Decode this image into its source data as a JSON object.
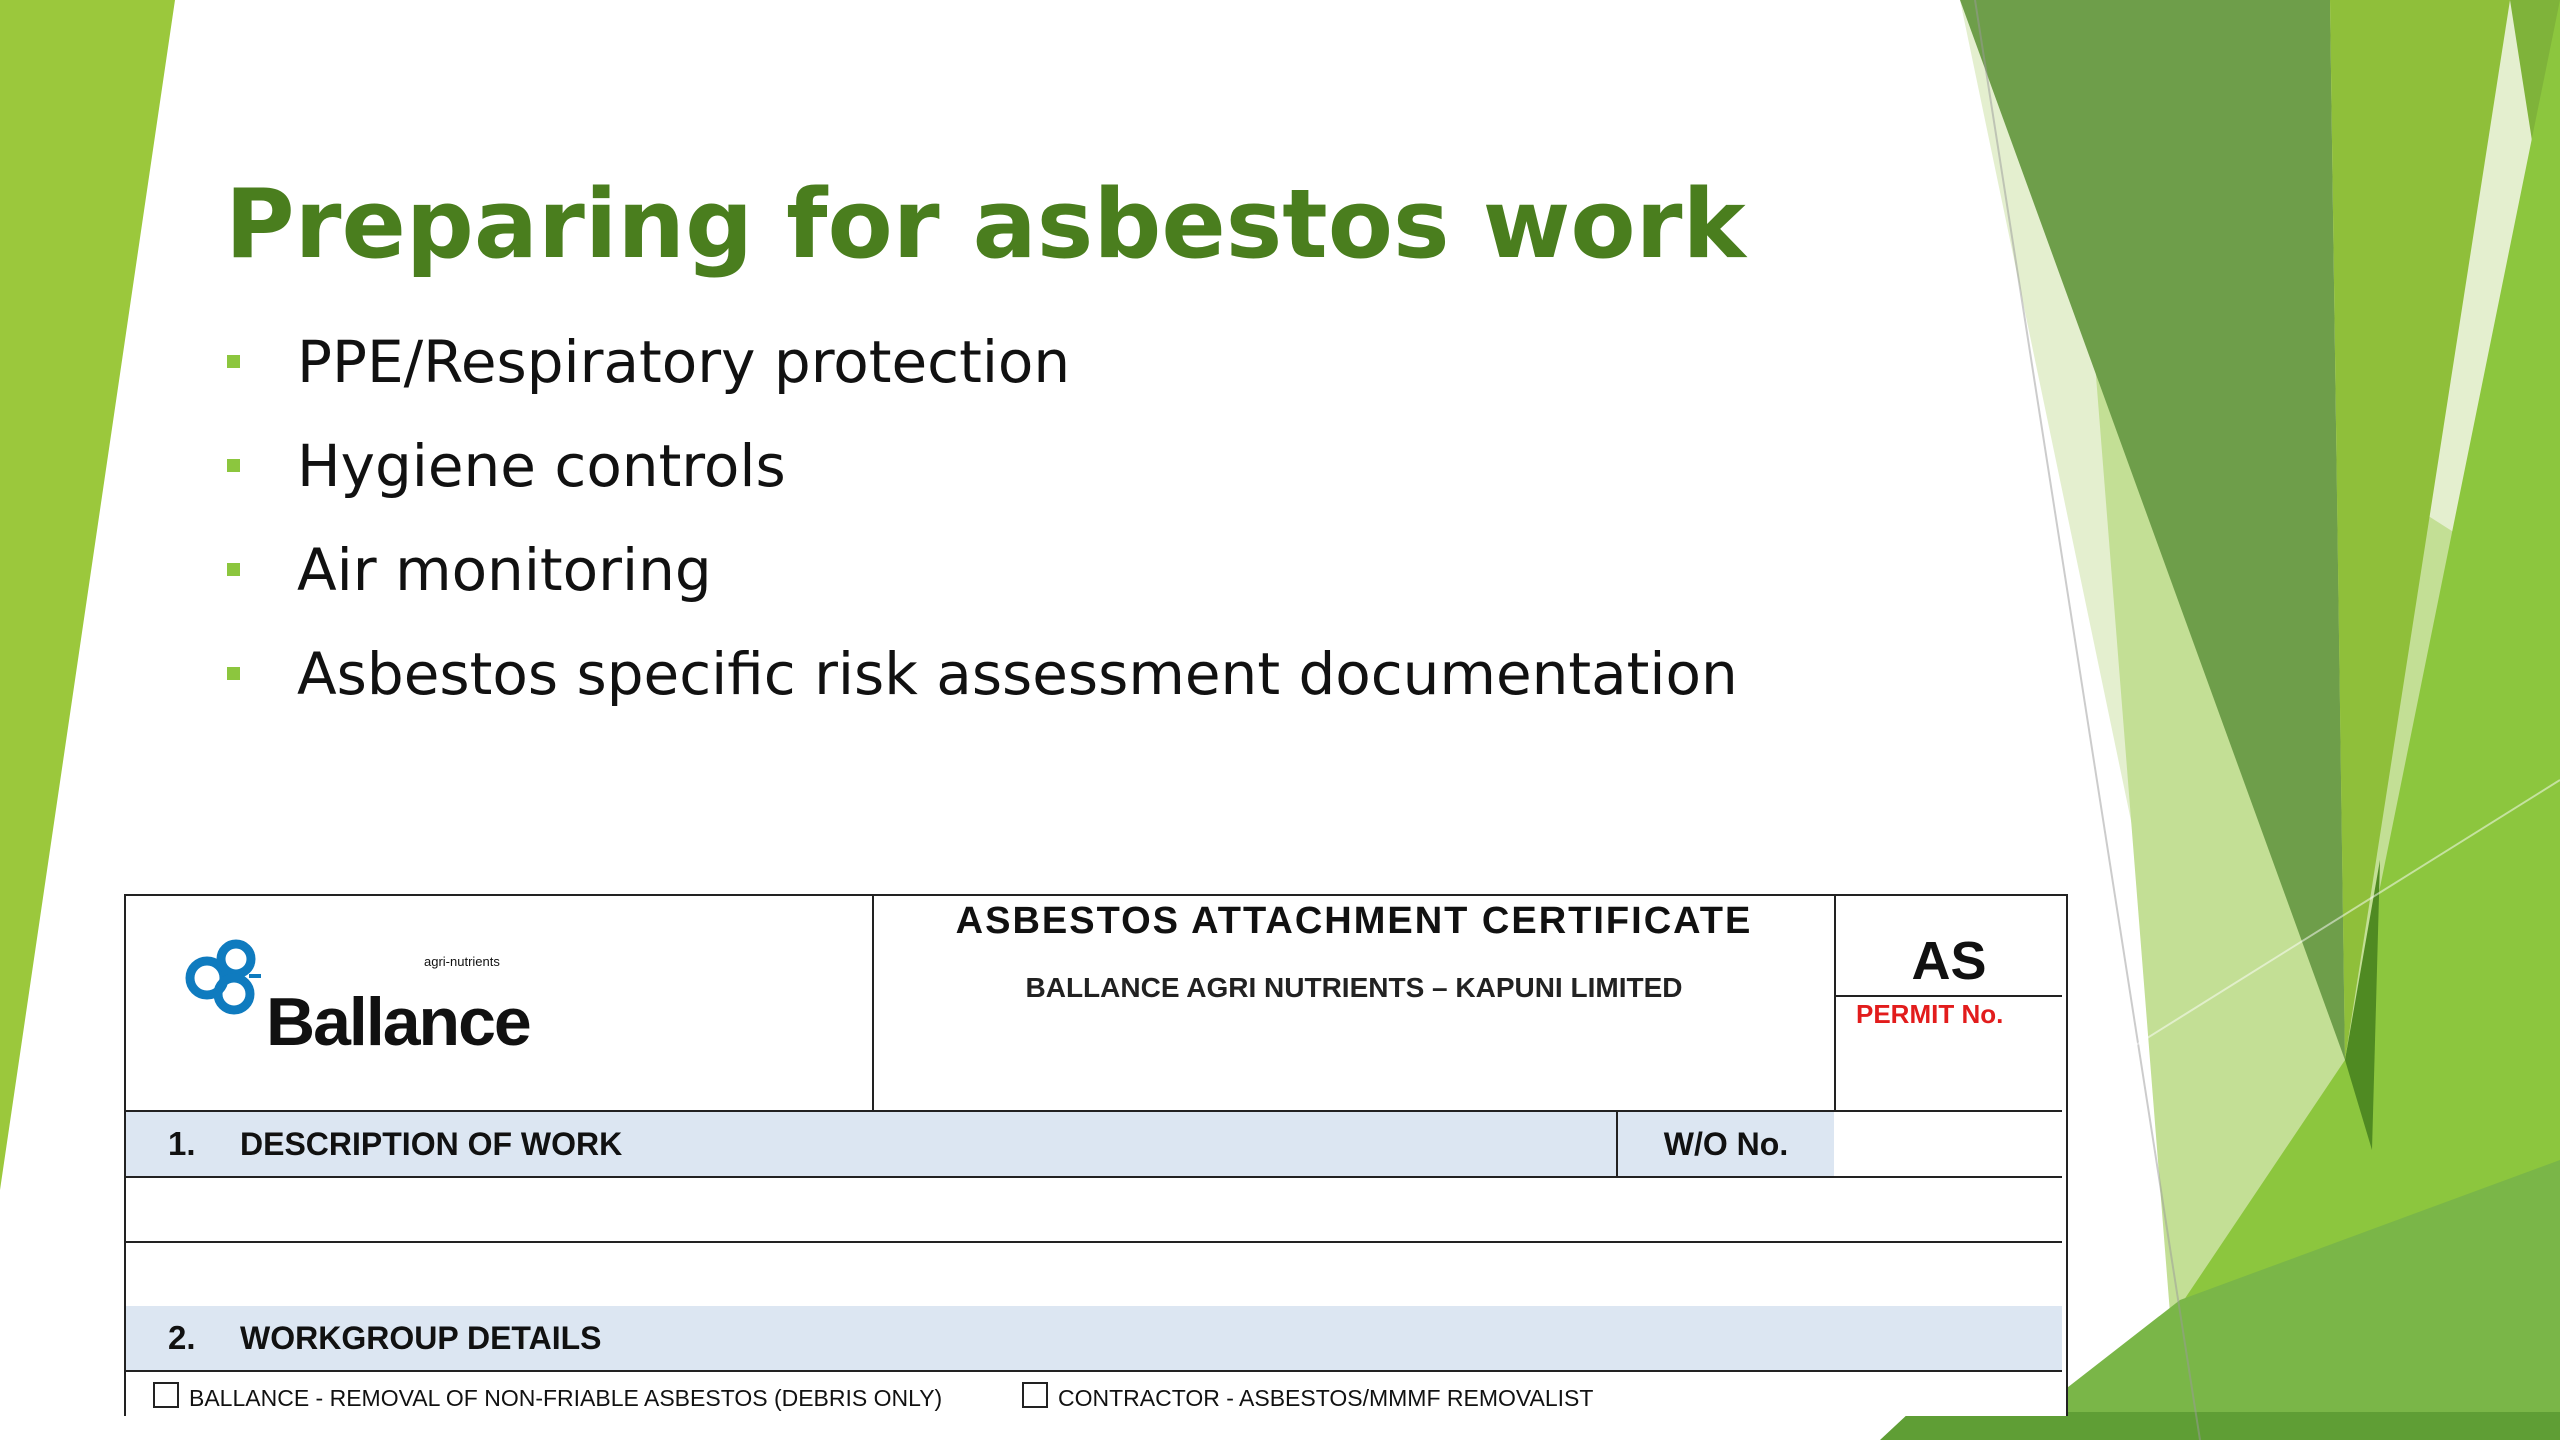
{
  "slide": {
    "title": "Preparing for asbestos work",
    "bullets": [
      "PPE/Respiratory protection",
      "Hygiene controls",
      "Air monitoring",
      "Asbestos specific risk assessment documentation"
    ],
    "colors": {
      "title": "#4a7e1e",
      "bullet_marker": "#8cc63e",
      "decor_light_green": "#9bc83c",
      "decor_dark_green": "#6e9e4a"
    }
  },
  "form": {
    "logo": {
      "brand": "Ballance",
      "subtitle": "agri-nutrients",
      "icon": "ballance-logo-icon"
    },
    "certificate_title": "ASBESTOS ATTACHMENT CERTIFICATE",
    "company": "BALLANCE AGRI NUTRIENTS – KAPUNI LIMITED",
    "permit_code": "AS",
    "permit_label": "PERMIT No.",
    "sections": [
      {
        "number": "1.",
        "label": "DESCRIPTION OF WORK"
      },
      {
        "number": "2.",
        "label": "WORKGROUP DETAILS"
      }
    ],
    "wo_label": "W/O No.",
    "options": [
      "BALLANCE - REMOVAL OF NON-FRIABLE ASBESTOS (DEBRIS ONLY)",
      "CONTRACTOR - ASBESTOS/MMMF REMOVALIST"
    ],
    "colors": {
      "section_fill": "#dce6f2",
      "permit_label": "#e21c1c"
    }
  }
}
